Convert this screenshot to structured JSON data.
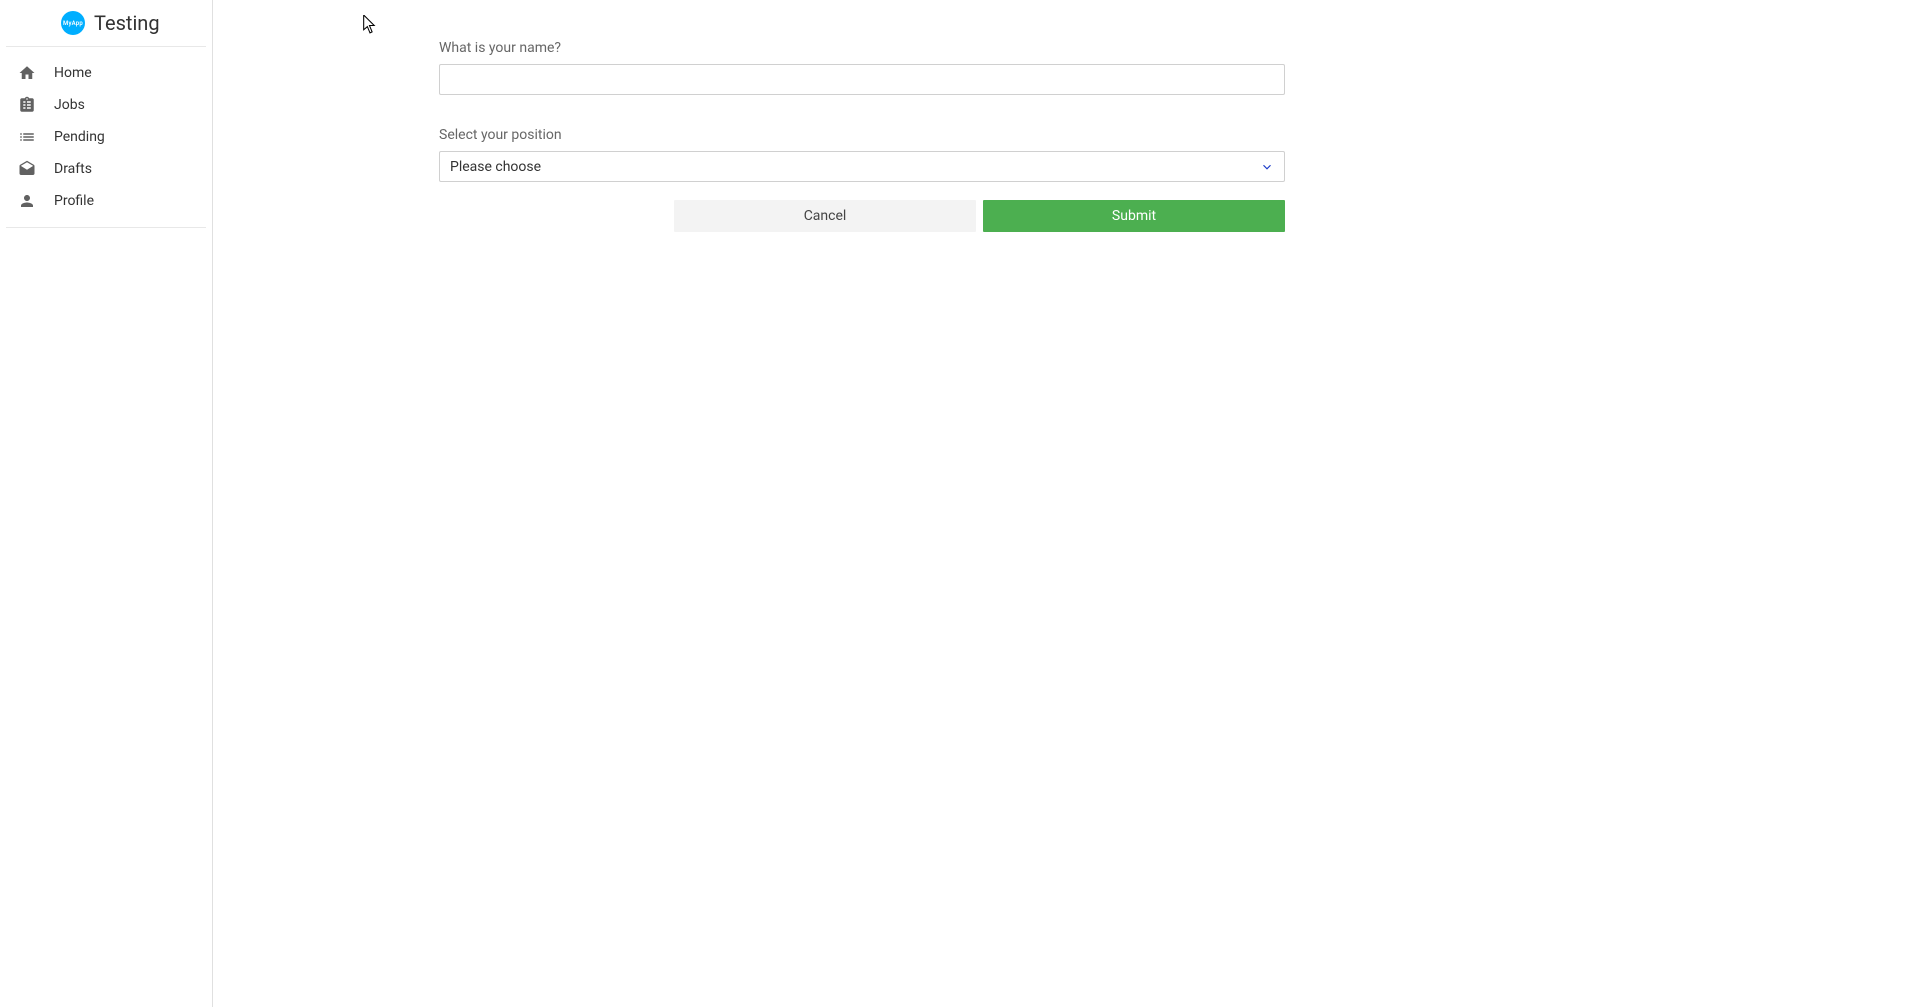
{
  "brand": {
    "logo_text": "MyApp",
    "title": "Testing"
  },
  "sidebar": {
    "items": [
      {
        "label": "Home",
        "icon": "home-icon"
      },
      {
        "label": "Jobs",
        "icon": "clipboard-icon"
      },
      {
        "label": "Pending",
        "icon": "list-icon"
      },
      {
        "label": "Drafts",
        "icon": "mail-icon"
      },
      {
        "label": "Profile",
        "icon": "person-icon"
      }
    ]
  },
  "form": {
    "name_label": "What is your name?",
    "name_value": "",
    "position_label": "Select your position",
    "position_selected": "Please choose",
    "cancel_label": "Cancel",
    "submit_label": "Submit"
  },
  "colors": {
    "brand_accent": "#00aeff",
    "submit": "#4caf50",
    "cancel": "#f3f3f3"
  }
}
